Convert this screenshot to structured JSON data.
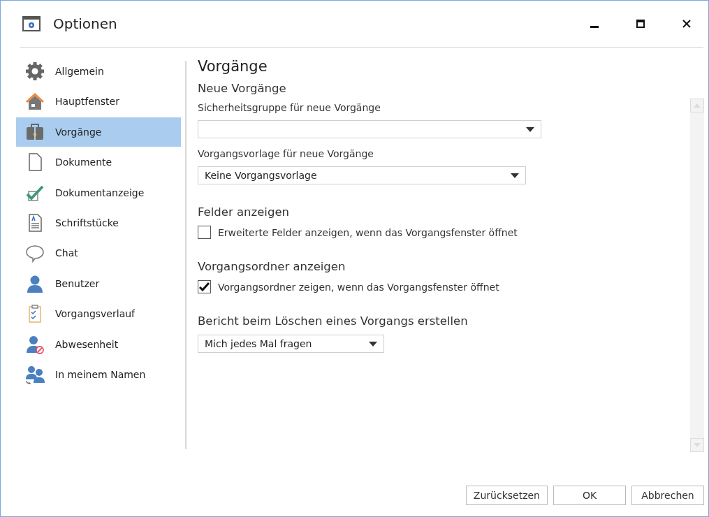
{
  "window": {
    "title": "Optionen"
  },
  "sidebar": {
    "items": [
      {
        "label": "Allgemein",
        "selected": false
      },
      {
        "label": "Hauptfenster",
        "selected": false
      },
      {
        "label": "Vorgänge",
        "selected": true
      },
      {
        "label": "Dokumente",
        "selected": false
      },
      {
        "label": "Dokumentanzeige",
        "selected": false
      },
      {
        "label": "Schriftstücke",
        "selected": false
      },
      {
        "label": "Chat",
        "selected": false
      },
      {
        "label": "Benutzer",
        "selected": false
      },
      {
        "label": "Vorgangsverlauf",
        "selected": false
      },
      {
        "label": "Abwesenheit",
        "selected": false
      },
      {
        "label": "In meinem Namen",
        "selected": false
      }
    ]
  },
  "content": {
    "title": "Vorgänge",
    "sections": [
      {
        "heading": "Neue Vorgänge",
        "fields": [
          {
            "kind": "dropdown",
            "label": "Sicherheitsgruppe für neue Vorgänge"
          },
          {
            "kind": "dropdown",
            "label": "Vorgangsvorlage für neue Vorgänge",
            "value": "Keine Vorgangsvorlage"
          }
        ]
      },
      {
        "heading": "Felder anzeigen",
        "fields": [
          {
            "kind": "checkbox",
            "label": "Erweiterte Felder anzeigen, wenn das Vorgangsfenster öffnet",
            "checked": false
          }
        ]
      },
      {
        "heading": "Vorgangsordner anzeigen",
        "fields": [
          {
            "kind": "checkbox",
            "label": "Vorgangsordner zeigen, wenn das Vorgangsfenster öffnet",
            "checked": true
          }
        ]
      },
      {
        "heading": "Bericht beim Löschen eines Vorgangs erstellen",
        "fields": [
          {
            "kind": "dropdown",
            "value": "Mich jedes Mal fragen"
          }
        ]
      }
    ]
  },
  "buttons": [
    "Zurücksetzen",
    "OK",
    "Abbrechen"
  ]
}
